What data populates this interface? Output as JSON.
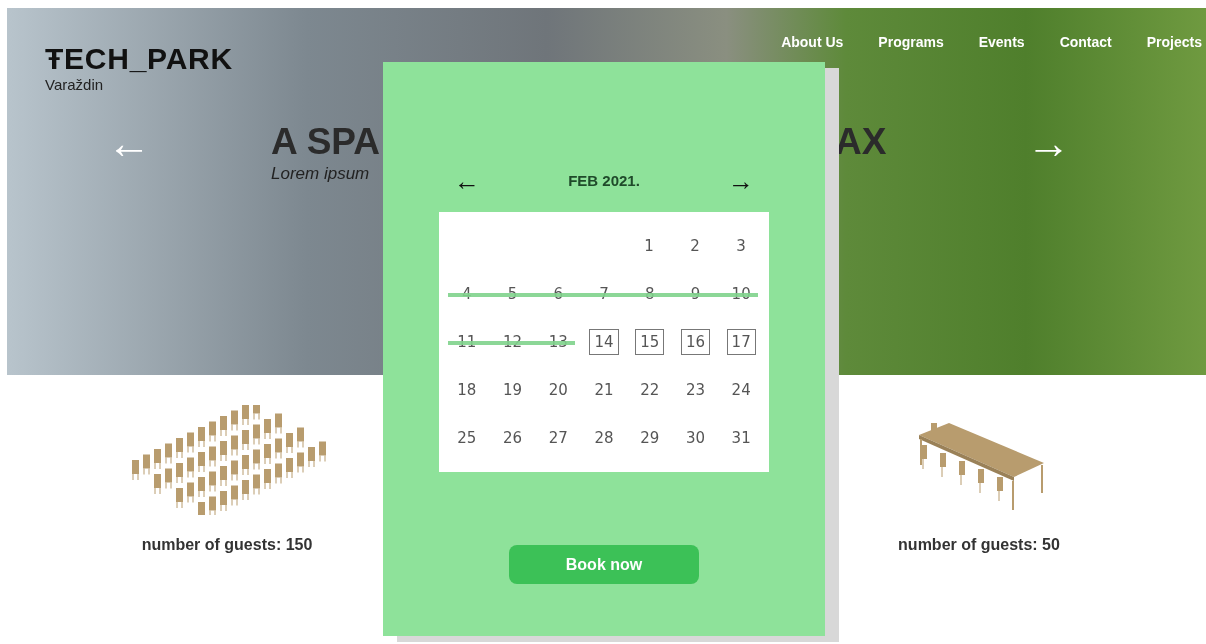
{
  "brand": {
    "name": "ŦECH_PARK",
    "city": "Varaždin"
  },
  "nav": [
    {
      "label": "About Us"
    },
    {
      "label": "Programs"
    },
    {
      "label": "Events"
    },
    {
      "label": "Contact"
    },
    {
      "label": "Projects"
    }
  ],
  "hero": {
    "title_left": "A SPA",
    "title_right": "AX",
    "subtitle": "Lorem ipsum",
    "prev": "←",
    "next": "→"
  },
  "rooms": [
    {
      "kind": "rows",
      "guests": "number of guests: 150"
    },
    {
      "kind": "table",
      "guests": "number of guests: 50"
    }
  ],
  "booking": {
    "prev": "←",
    "month": "FEB 2021.",
    "next": "→",
    "button": "Book now",
    "weeks": [
      {
        "days": [
          {
            "day": "1",
            "kind": "normal"
          },
          {
            "day": "2",
            "kind": "normal"
          },
          {
            "day": "3",
            "kind": "normal"
          }
        ]
      },
      {
        "days": [
          {
            "day": "4",
            "kind": "blocked"
          },
          {
            "day": "5",
            "kind": "blocked"
          },
          {
            "day": "6",
            "kind": "blocked"
          },
          {
            "day": "7",
            "kind": "blocked"
          },
          {
            "day": "8",
            "kind": "blocked"
          },
          {
            "day": "9",
            "kind": "blocked"
          },
          {
            "day": "10",
            "kind": "blocked"
          }
        ]
      },
      {
        "days": [
          {
            "day": "11",
            "kind": "blocked"
          },
          {
            "day": "12",
            "kind": "blocked"
          },
          {
            "day": "13",
            "kind": "blocked"
          },
          {
            "day": "14",
            "kind": "available"
          },
          {
            "day": "15",
            "kind": "available"
          },
          {
            "day": "16",
            "kind": "available"
          },
          {
            "day": "17",
            "kind": "available"
          }
        ]
      },
      {
        "days": [
          {
            "day": "18",
            "kind": "normal"
          },
          {
            "day": "19",
            "kind": "normal"
          },
          {
            "day": "20",
            "kind": "normal"
          },
          {
            "day": "21",
            "kind": "normal"
          },
          {
            "day": "22",
            "kind": "normal"
          },
          {
            "day": "23",
            "kind": "normal"
          },
          {
            "day": "24",
            "kind": "normal"
          }
        ]
      },
      {
        "days": [
          {
            "day": "25",
            "kind": "normal"
          },
          {
            "day": "26",
            "kind": "normal"
          },
          {
            "day": "27",
            "kind": "normal"
          },
          {
            "day": "28",
            "kind": "normal"
          },
          {
            "day": "29",
            "kind": "normal"
          },
          {
            "day": "30",
            "kind": "normal"
          },
          {
            "day": "31",
            "kind": "normal"
          }
        ]
      }
    ]
  }
}
